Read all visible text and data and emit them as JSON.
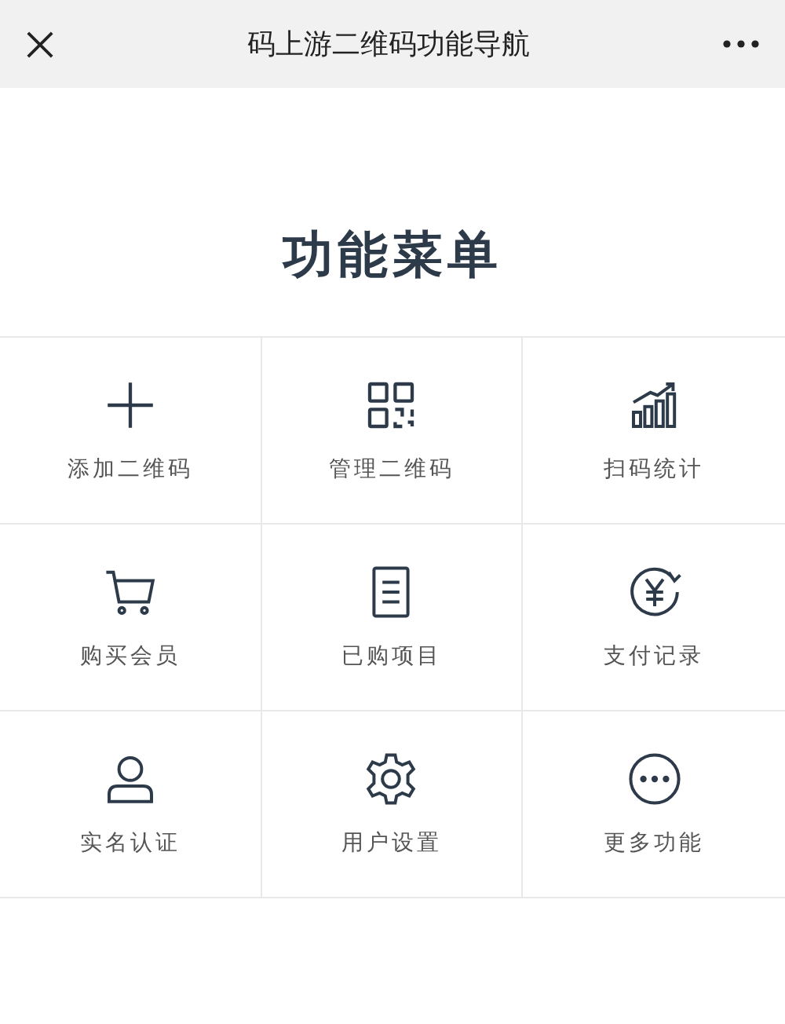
{
  "nav_bar": {
    "title": "码上游二维码功能导航"
  },
  "heading": "功能菜单",
  "menu": [
    {
      "label": "添加二维码",
      "kind": "plus"
    },
    {
      "label": "管理二维码",
      "kind": "qrcode"
    },
    {
      "label": "扫码统计",
      "kind": "chart"
    },
    {
      "label": "购买会员",
      "kind": "cart"
    },
    {
      "label": "已购项目",
      "kind": "document"
    },
    {
      "label": "支付记录",
      "kind": "yen"
    },
    {
      "label": "实名认证",
      "kind": "person"
    },
    {
      "label": "用户设置",
      "kind": "gear"
    },
    {
      "label": "更多功能",
      "kind": "more"
    }
  ]
}
